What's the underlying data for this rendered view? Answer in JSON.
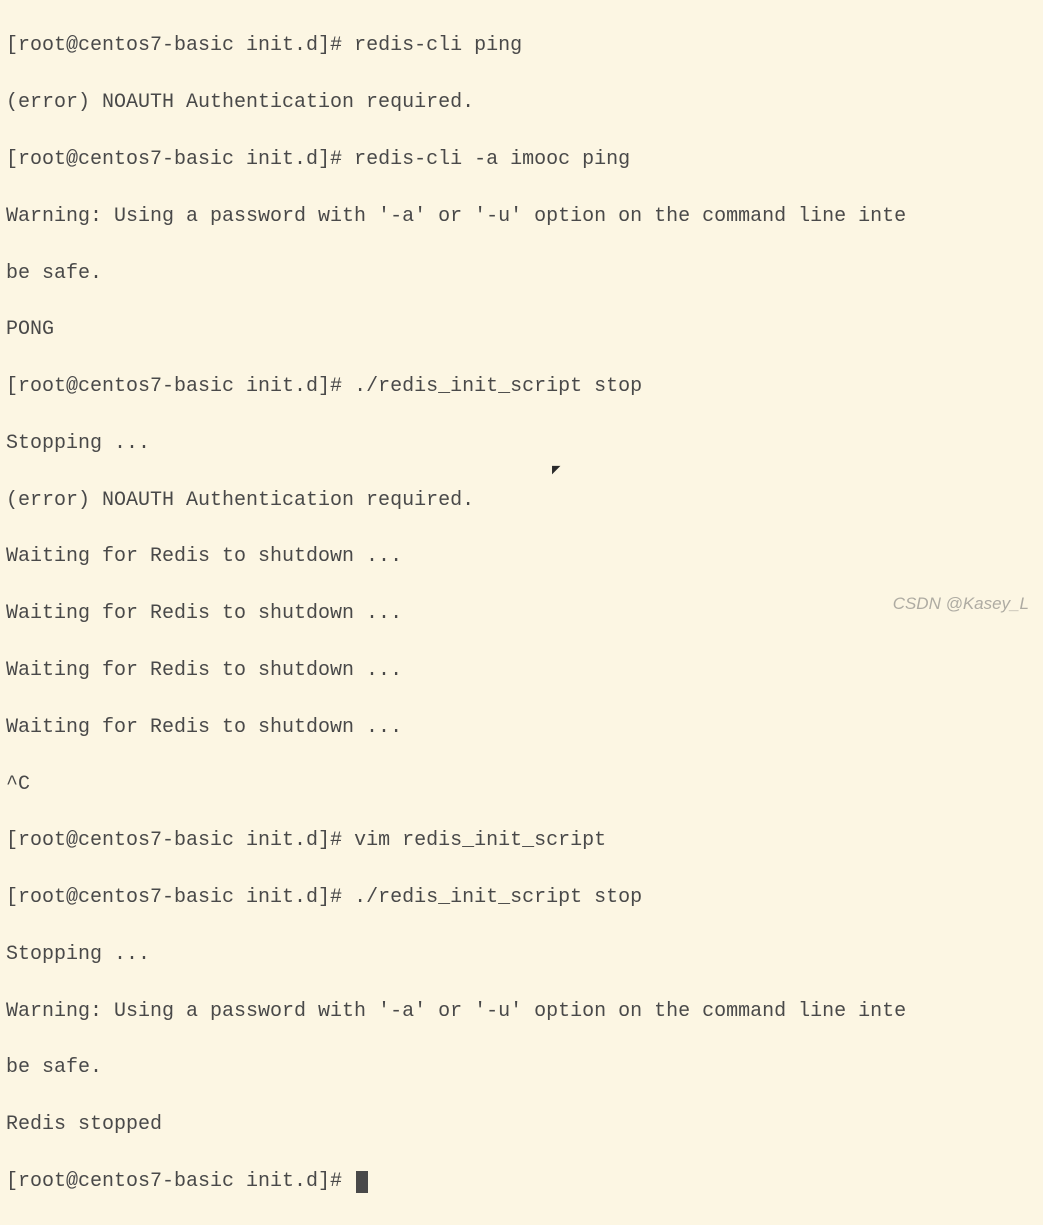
{
  "prompt": "[root@centos7-basic init.d]# ",
  "lines": {
    "l0_cmd": "redis-cli ping",
    "l1": "(error) NOAUTH Authentication required.",
    "l2_cmd": "redis-cli -a imooc ping",
    "l3": "Warning: Using a password with '-a' or '-u' option on the command line inte",
    "l4": "be safe.",
    "l5": "PONG",
    "l6_cmd": "./redis_init_script stop",
    "l7": "Stopping ...",
    "l8": "(error) NOAUTH Authentication required.",
    "l9": "Waiting for Redis to shutdown ...",
    "l10": "Waiting for Redis to shutdown ...",
    "l11": "Waiting for Redis to shutdown ...",
    "l12": "Waiting for Redis to shutdown ...",
    "l13": "^C",
    "l14_cmd": "vim redis_init_script",
    "l15_cmd": "./redis_init_script stop",
    "l16": "Stopping ...",
    "l17": "Warning: Using a password with '-a' or '-u' option on the command line inte",
    "l18": "be safe.",
    "l19": "Redis stopped"
  },
  "watermark": "CSDN @Kasey_L"
}
